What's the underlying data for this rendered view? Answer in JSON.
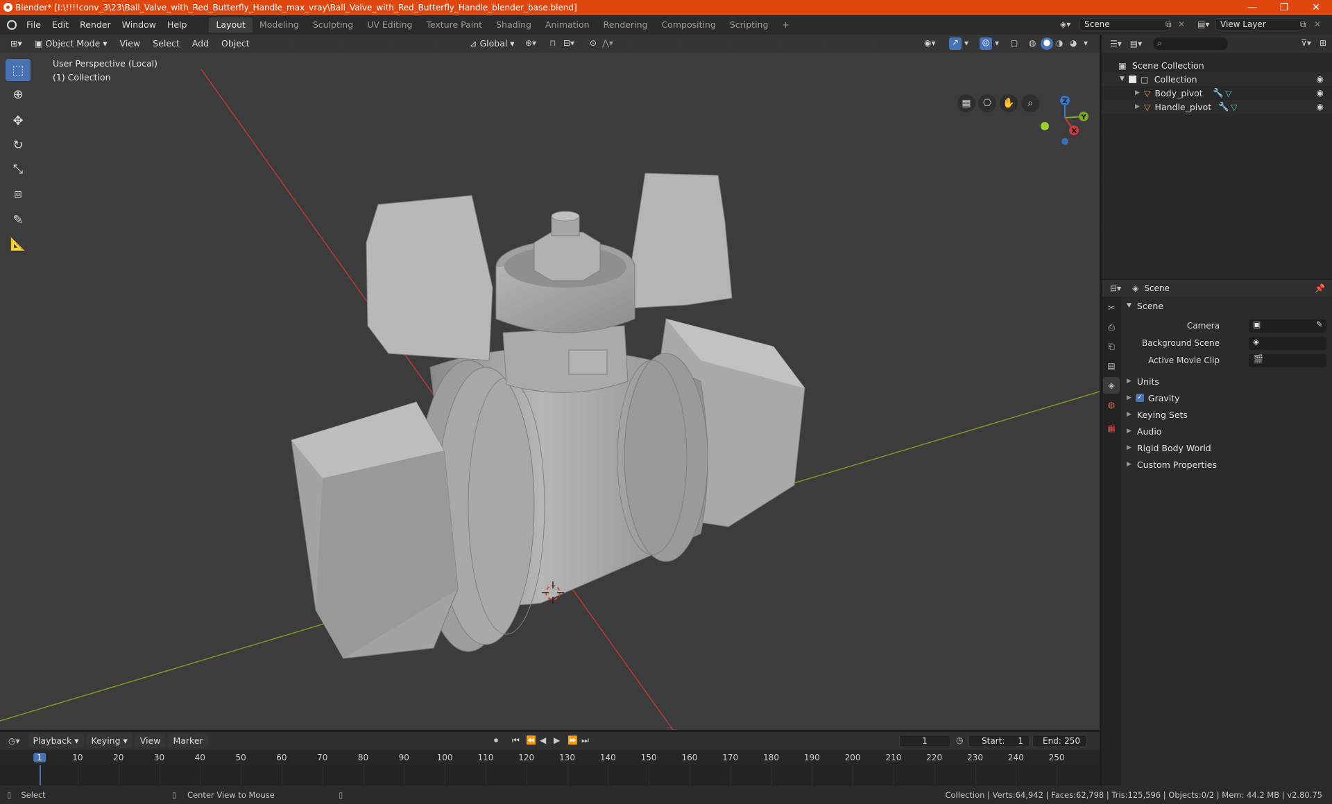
{
  "window": {
    "title": "Blender* [I:\\!!!!conv_3\\23\\Ball_Valve_with_Red_Butterfly_Handle_max_vray\\Ball_Valve_with_Red_Butterfly_Handle_blender_base.blend]",
    "minimize": "—",
    "restore": "❐",
    "close": "✕"
  },
  "menu": [
    "File",
    "Edit",
    "Render",
    "Window",
    "Help"
  ],
  "workspaces": {
    "active": "Layout",
    "tabs": [
      "Layout",
      "Modeling",
      "Sculpting",
      "UV Editing",
      "Texture Paint",
      "Shading",
      "Animation",
      "Rendering",
      "Compositing",
      "Scripting"
    ],
    "add": "+"
  },
  "scene": {
    "name": "Scene",
    "view_layer": "View Layer"
  },
  "viewport": {
    "mode": "Object Mode",
    "menus": [
      "View",
      "Select",
      "Add",
      "Object"
    ],
    "transform_orientation": "Global",
    "perspective_label": "User Perspective (Local)",
    "collection_label": "(1) Collection",
    "gizmo": {
      "z": "Z",
      "y": "Y",
      "x": "X"
    }
  },
  "outliner": {
    "root": "Scene Collection",
    "collection": "Collection",
    "objects": [
      "Body_pivot",
      "Handle_pivot"
    ]
  },
  "properties": {
    "context": "Scene",
    "panel": "Scene",
    "fields": [
      "Camera",
      "Background Scene",
      "Active Movie Clip"
    ],
    "sections": [
      "Units",
      "Gravity",
      "Keying Sets",
      "Audio",
      "Rigid Body World",
      "Custom Properties"
    ]
  },
  "timeline": {
    "menus": [
      "Playback",
      "Keying",
      "View",
      "Marker"
    ],
    "current_frame": "1",
    "start_label": "Start:",
    "start": "1",
    "end_label": "End:",
    "end": "250",
    "ticks": [
      "1",
      "10",
      "20",
      "30",
      "40",
      "50",
      "60",
      "70",
      "80",
      "90",
      "100",
      "110",
      "120",
      "130",
      "140",
      "150",
      "160",
      "170",
      "180",
      "190",
      "200",
      "210",
      "220",
      "230",
      "240",
      "250"
    ]
  },
  "status": {
    "left": "Select",
    "middle": "Center View to Mouse",
    "right": "Collection | Verts:64,942 | Faces:62,798 | Tris:125,596 | Objects:0/2 | Mem: 44.2 MB | v2.80.75"
  },
  "colors": {
    "accent": "#4772b3",
    "titlebar": "#e0470f",
    "x_axis": "#b83a3a",
    "y_axis": "#7a9a2a",
    "object_orange": "#e8923a"
  }
}
